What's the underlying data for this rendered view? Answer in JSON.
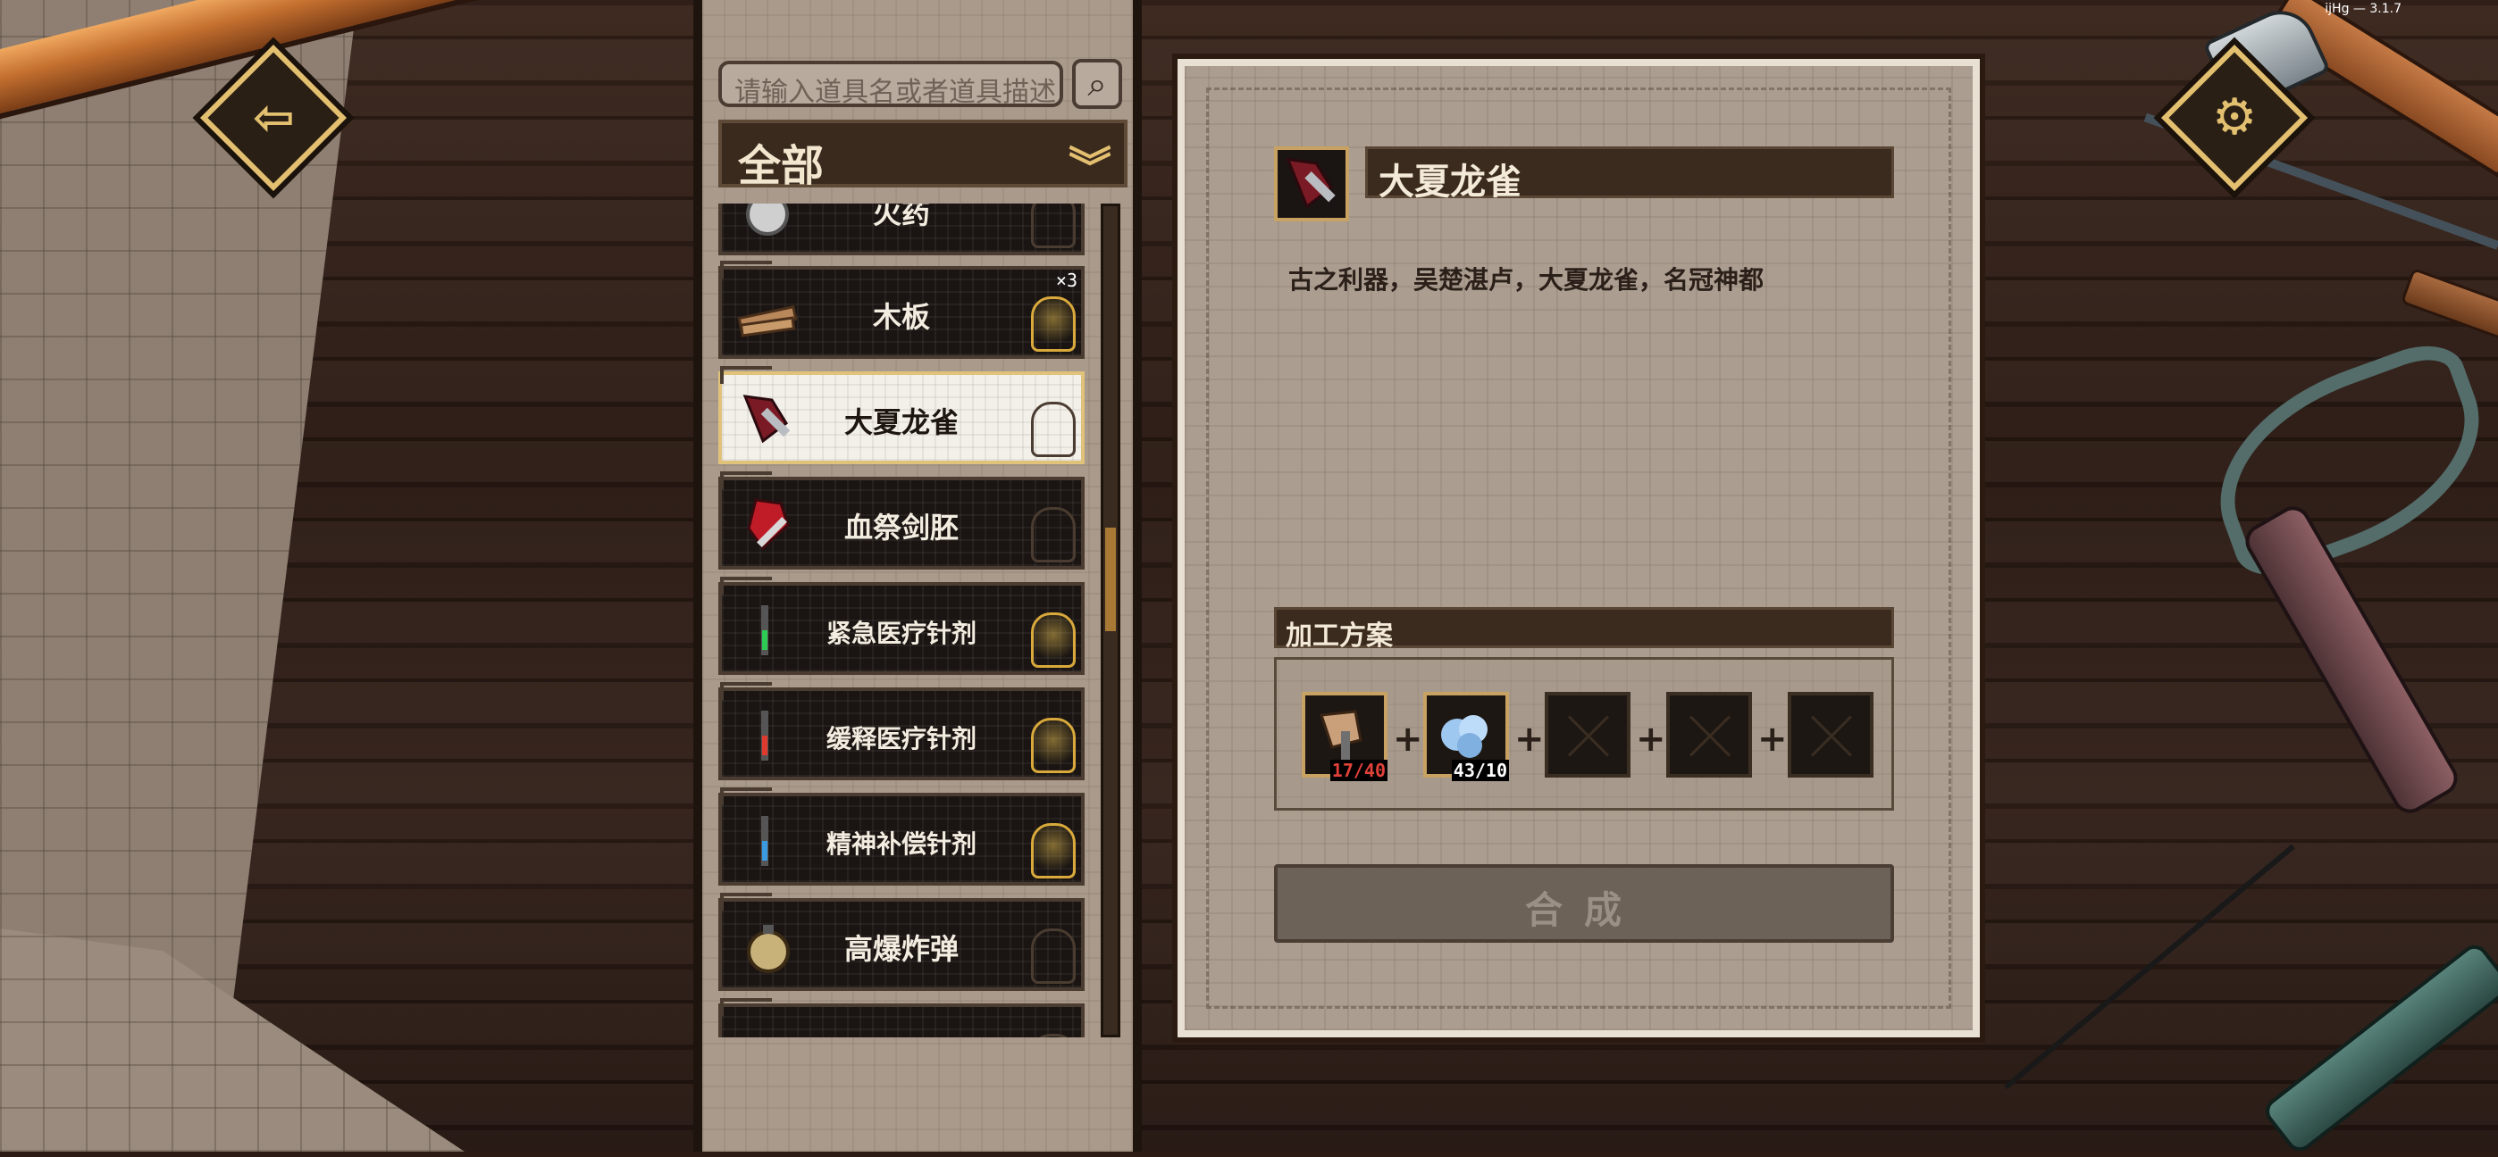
{
  "version_text": "ijHg — 3.1.7",
  "buttons": {
    "back_glyph": "⇦",
    "settings_glyph": "⚙",
    "search_glyph": "🔍"
  },
  "search": {
    "placeholder": "请输入道具名或者道具描述"
  },
  "category": {
    "label": "全部",
    "chevron": "≫"
  },
  "items": [
    {
      "name": "火药",
      "selected": false,
      "lit": false,
      "icon": "gunpowder-icon",
      "badge": ""
    },
    {
      "name": "木板",
      "selected": false,
      "lit": true,
      "icon": "plank-icon",
      "badge": "×3"
    },
    {
      "name": "大夏龙雀",
      "selected": true,
      "lit": false,
      "icon": "sword-icon",
      "badge": ""
    },
    {
      "name": "血祭剑胚",
      "selected": false,
      "lit": false,
      "icon": "blood-blade-icon",
      "badge": ""
    },
    {
      "name": "紧急医疗针剂",
      "selected": false,
      "lit": true,
      "icon": "syringe-green-icon",
      "badge": ""
    },
    {
      "name": "缓释医疗针剂",
      "selected": false,
      "lit": true,
      "icon": "syringe-red-icon",
      "badge": ""
    },
    {
      "name": "精神补偿针剂",
      "selected": false,
      "lit": true,
      "icon": "syringe-blue-icon",
      "badge": ""
    },
    {
      "name": "高爆炸弹",
      "selected": false,
      "lit": false,
      "icon": "bomb-icon",
      "badge": ""
    }
  ],
  "detail": {
    "title": "大夏龙雀",
    "description": "古之利器，吴楚湛卢，大夏龙雀，名冠神都",
    "recipe_section_title": "加工方案",
    "ingredients": [
      {
        "icon": "axe-parts-icon",
        "count": "17/40",
        "sufficient": false
      },
      {
        "icon": "ore-crystal-icon",
        "count": "43/10",
        "sufficient": true
      },
      {
        "icon": "empty-slot-icon",
        "count": ""
      },
      {
        "icon": "empty-slot-icon",
        "count": ""
      },
      {
        "icon": "empty-slot-icon",
        "count": ""
      }
    ],
    "plus": "+",
    "craft_label": "合成"
  },
  "colors": {
    "accent_gold": "#e3c070",
    "lack_red": "#e0413a",
    "panel_dark": "#3b2b1f"
  }
}
